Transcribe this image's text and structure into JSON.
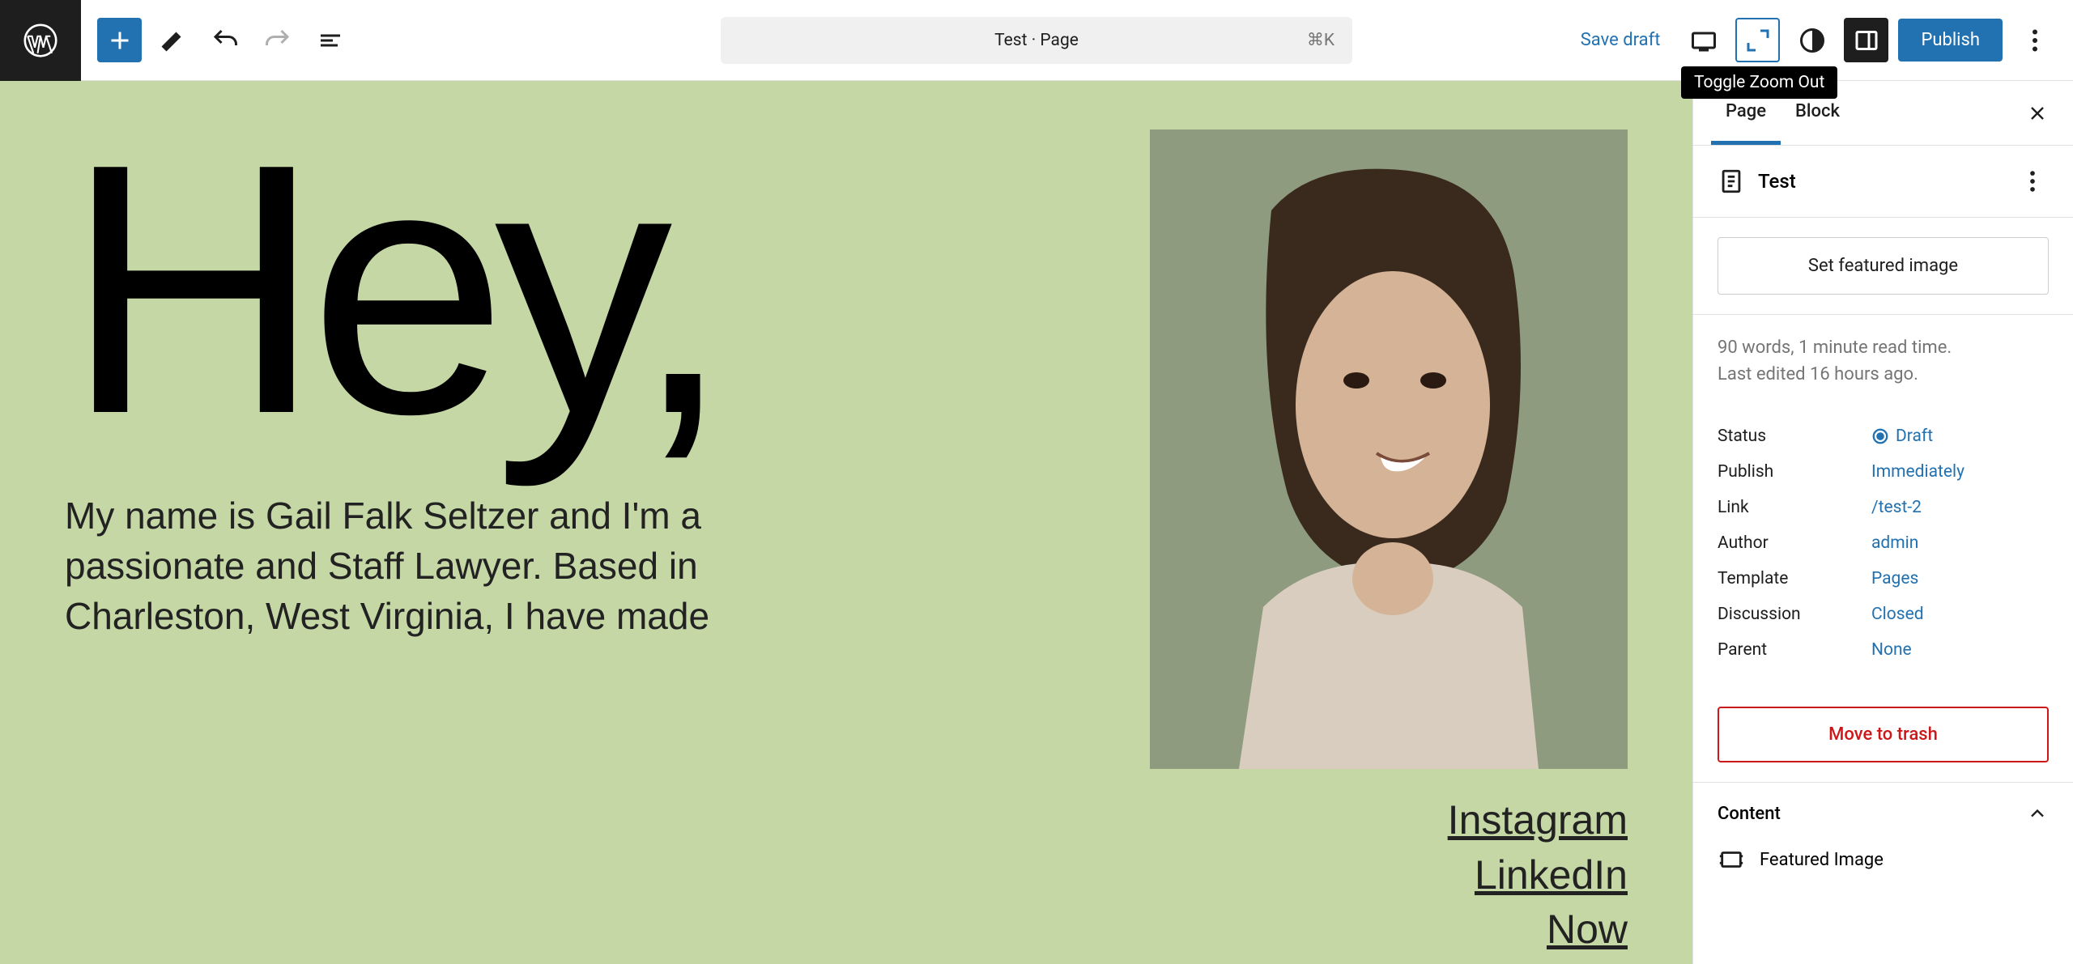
{
  "topbar": {
    "save_draft": "Save draft",
    "publish": "Publish",
    "tooltip_zoom": "Toggle Zoom Out"
  },
  "breadcrumb": {
    "title": "Test · Page",
    "shortcut": "⌘K"
  },
  "canvas": {
    "heading": "Hey,",
    "bio": "My name is Gail Falk Seltzer and I'm a passionate and Staff Lawyer. Based in Charleston, West Virginia, I have made",
    "links": [
      "Instagram",
      "LinkedIn",
      "Now"
    ]
  },
  "sidebar": {
    "tabs": {
      "page": "Page",
      "block": "Block"
    },
    "page_title": "Test",
    "featured_button": "Set featured image",
    "stats": {
      "words": "90 words, 1 minute read time.",
      "edited": "Last edited 16 hours ago."
    },
    "fields": {
      "status": {
        "label": "Status",
        "value": "Draft"
      },
      "publish": {
        "label": "Publish",
        "value": "Immediately"
      },
      "link": {
        "label": "Link",
        "value": "/test-2"
      },
      "author": {
        "label": "Author",
        "value": "admin"
      },
      "template": {
        "label": "Template",
        "value": "Pages"
      },
      "discussion": {
        "label": "Discussion",
        "value": "Closed"
      },
      "parent": {
        "label": "Parent",
        "value": "None"
      }
    },
    "trash": "Move to trash",
    "content": {
      "header": "Content",
      "featured_image": "Featured Image"
    }
  }
}
